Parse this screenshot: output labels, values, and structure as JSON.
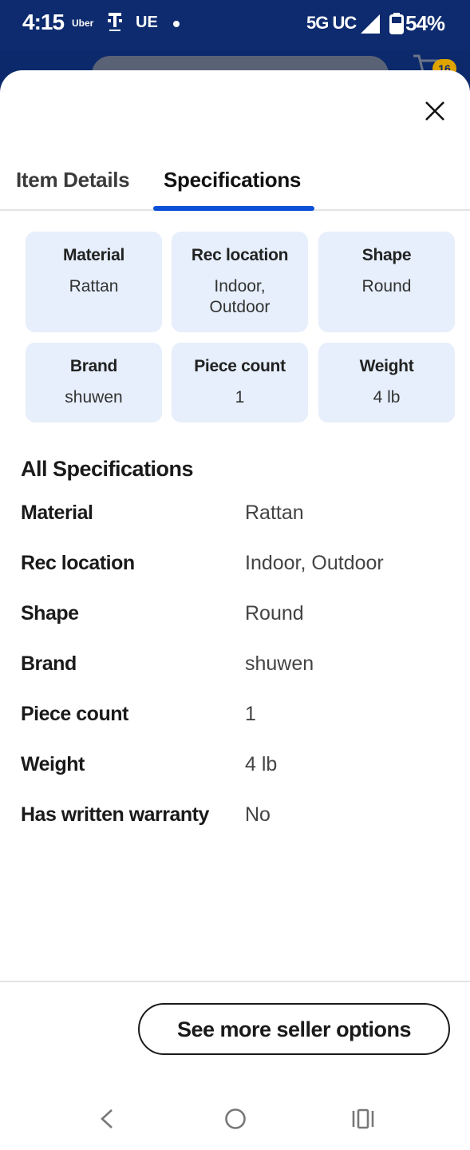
{
  "status_bar": {
    "time": "4:15",
    "uber_label": "Uber",
    "ue_label": "UE",
    "network": "5G UC",
    "battery": "54%"
  },
  "background": {
    "cart_count": "16"
  },
  "tabs": [
    {
      "label": "Item Details",
      "selected": false
    },
    {
      "label": "Specifications",
      "selected": true
    }
  ],
  "tiles": [
    {
      "label": "Material",
      "value": "Rattan"
    },
    {
      "label": "Rec location",
      "value": "Indoor, Outdoor"
    },
    {
      "label": "Shape",
      "value": "Round"
    },
    {
      "label": "Brand",
      "value": "shuwen"
    },
    {
      "label": "Piece count",
      "value": "1"
    },
    {
      "label": "Weight",
      "value": "4 lb"
    }
  ],
  "all_specs": {
    "title": "All Specifications",
    "rows": [
      {
        "name": "Material",
        "value": "Rattan"
      },
      {
        "name": "Rec location",
        "value": "Indoor, Outdoor"
      },
      {
        "name": "Shape",
        "value": "Round"
      },
      {
        "name": "Brand",
        "value": "shuwen"
      },
      {
        "name": "Piece count",
        "value": "1"
      },
      {
        "name": "Weight",
        "value": "4 lb"
      },
      {
        "name": "Has written warranty",
        "value": "No"
      }
    ]
  },
  "footer": {
    "seller_button": "See more seller options"
  },
  "colors": {
    "status_bar_bg": "#0d2b6e",
    "tab_underline": "#0a4fd6",
    "tile_bg": "#e6effb",
    "cart_badge": "#e0a400"
  },
  "icons": {
    "close": "close-icon",
    "cart": "cart-icon",
    "signal": "signal-icon",
    "battery": "battery-icon",
    "nav_back": "back-chevron-icon",
    "nav_home": "home-circle-icon",
    "nav_recent": "recent-apps-icon"
  }
}
